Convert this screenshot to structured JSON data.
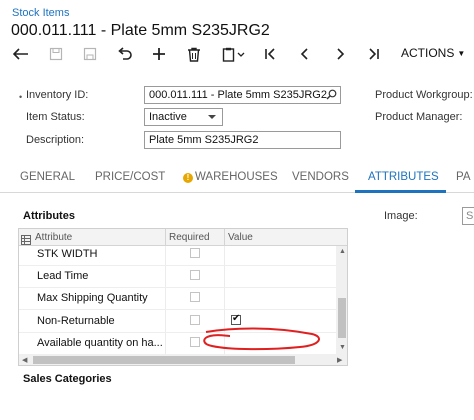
{
  "breadcrumb": "Stock Items",
  "title": "000.011.111 - Plate 5mm S235JRG2",
  "toolbar": {
    "icons": [
      "back-arrow-icon",
      "add-record-icon",
      "save-icon",
      "undo-icon",
      "plus-icon",
      "trash-icon",
      "copy-paste-icon",
      "first-record-icon",
      "previous-record-icon",
      "next-record-icon",
      "last-record-icon"
    ],
    "actions_label": "ACTIONS"
  },
  "form": {
    "inventory_id_label": "Inventory ID:",
    "inventory_id_value": "000.011.111 - Plate 5mm S235JRG2",
    "item_status_label": "Item Status:",
    "item_status_value": "Inactive",
    "description_label": "Description:",
    "description_value": "Plate 5mm S235JRG2",
    "product_workgroup_label": "Product Workgroup:",
    "product_manager_label": "Product Manager:"
  },
  "tabs": [
    {
      "label": "GENERAL",
      "active": false
    },
    {
      "label": "PRICE/COST",
      "active": false
    },
    {
      "label": "WAREHOUSES",
      "active": false,
      "warning": true
    },
    {
      "label": "VENDORS",
      "active": false
    },
    {
      "label": "ATTRIBUTES",
      "active": true
    },
    {
      "label": "PA",
      "active": false
    }
  ],
  "attributes": {
    "section_title": "Attributes",
    "columns": [
      "Attribute",
      "Required",
      "Value"
    ],
    "rows": [
      {
        "attribute": "STK WIDTH",
        "required": false,
        "value_checkbox": false
      },
      {
        "attribute": "Lead Time",
        "required": false,
        "value_checkbox": false
      },
      {
        "attribute": "Max Shipping Quantity",
        "required": false,
        "value_checkbox": false
      },
      {
        "attribute": "Non-Returnable",
        "required": false,
        "value_checkbox": true,
        "value_checked": true
      },
      {
        "attribute": "Available quantity on ha...",
        "required": false,
        "value_checkbox": false
      }
    ]
  },
  "image_label": "Image:",
  "image_value": "S",
  "sales_categories_title": "Sales Categories",
  "colors": {
    "accent": "#1e73be",
    "warning": "#e6a700",
    "annotation": "#e02020"
  }
}
